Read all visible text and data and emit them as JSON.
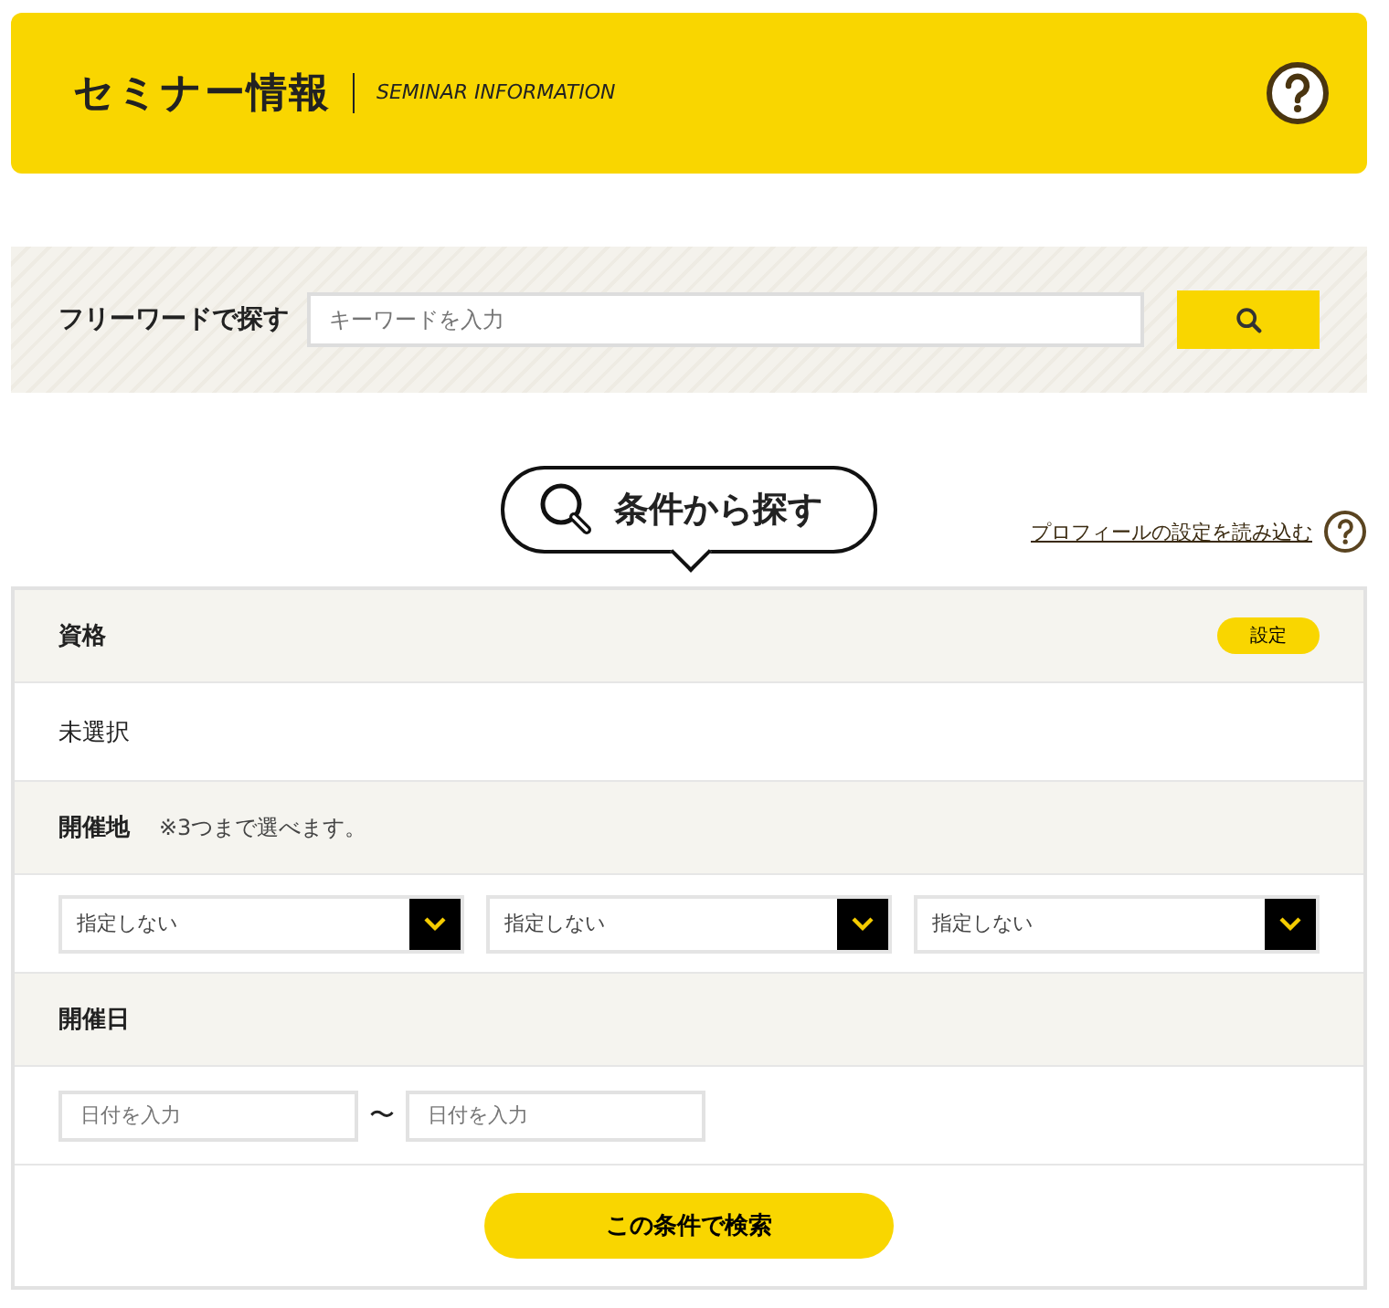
{
  "header": {
    "title": "セミナー情報",
    "subtitle": "SEMINAR INFORMATION"
  },
  "freeword": {
    "label": "フリーワードで探す",
    "placeholder": "キーワードを入力"
  },
  "conditions": {
    "title": "条件から探す",
    "profile_link": "プロフィールの設定を読み込む"
  },
  "qualification": {
    "label": "資格",
    "button": "設定",
    "value": "未選択"
  },
  "venue": {
    "label": "開催地",
    "note": "※3つまで選べます。",
    "selects": [
      "指定しない",
      "指定しない",
      "指定しない"
    ]
  },
  "date": {
    "label": "開催日",
    "from_placeholder": "日付を入力",
    "separator": "〜",
    "to_placeholder": "日付を入力"
  },
  "submit": "この条件で検索"
}
